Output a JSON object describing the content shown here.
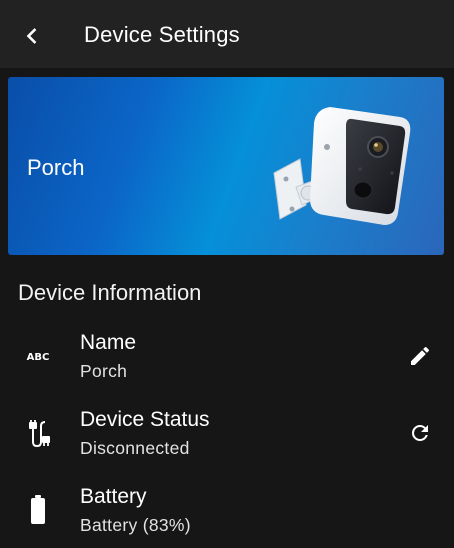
{
  "app_bar": {
    "title": "Device Settings",
    "back_icon": "chevron-left-icon"
  },
  "hero": {
    "device_name": "Porch",
    "image": "security-camera-image",
    "gradient_colors": [
      "#0a4ea8",
      "#0590d8",
      "#2b66ba"
    ]
  },
  "section": {
    "title": "Device Information"
  },
  "rows": [
    {
      "icon": "abc-text-icon",
      "title": "Name",
      "value": "Porch",
      "action_icon": "pencil-edit-icon"
    },
    {
      "icon": "cable-plug-icon",
      "title": "Device Status",
      "value": "Disconnected",
      "action_icon": "refresh-icon"
    },
    {
      "icon": "battery-icon",
      "title": "Battery",
      "value": "Battery (83%)",
      "battery_level": 0.83
    }
  ],
  "colors": {
    "background": "#161616",
    "app_bar": "#222222",
    "text": "#ffffff",
    "subtext": "#e2e2e2"
  }
}
